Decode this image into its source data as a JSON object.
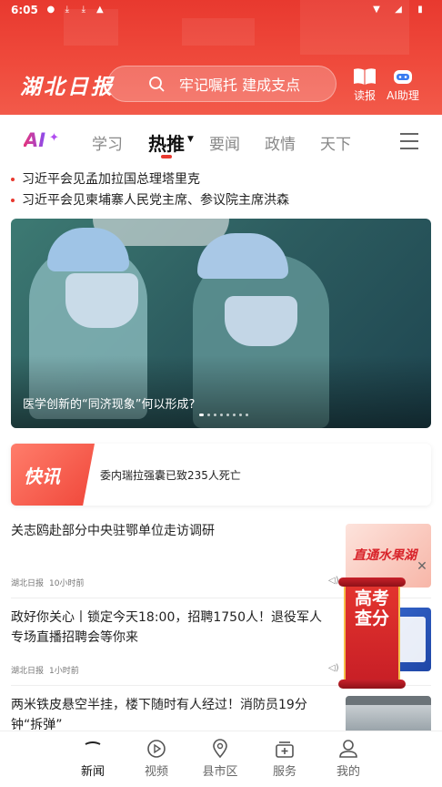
{
  "status_bar": {
    "time": "6:05"
  },
  "header": {
    "logo": "湖北日报",
    "search_placeholder": "牢记嘱托 建成支点",
    "read_paper_label": "读报",
    "ai_assistant_label": "AI助理"
  },
  "tabs": {
    "ai_label": "AI",
    "items": [
      "学习",
      "热推",
      "要闻",
      "政情",
      "天下"
    ],
    "active": "热推"
  },
  "top_headlines": [
    "习近平会见孟加拉国总理塔里克",
    "习近平会见柬埔寨人民党主席、参议院主席洪森"
  ],
  "banner": {
    "caption": "医学创新的“同济现象”何以形成?"
  },
  "flash": {
    "badge": "快讯",
    "text": "委内瑞拉强囊已致235人死亡"
  },
  "news": [
    {
      "title": "关志鸥赴部分中央驻鄂单位走访调研",
      "source": "湖北日报",
      "time": "10小时前",
      "thumb_text": "直通水果湖"
    },
    {
      "title": "政好你关心丨锁定今天18:00，招聘1750人！退役军人专场直播招聘会等你来",
      "source": "湖北日报",
      "time": "1小时前",
      "thumb_text": ""
    },
    {
      "title": "两米铁皮悬空半挂，楼下随时有人经过！消防员19分钟“拆弹”",
      "source": "",
      "time": "",
      "thumb_text": ""
    }
  ],
  "floating_ad": {
    "text": "高考查分"
  },
  "bottom_nav": {
    "items": [
      "新闻",
      "视频",
      "县市区",
      "服务",
      "我的"
    ],
    "active": "新闻"
  },
  "colors": {
    "brand_red": "#e8392f"
  }
}
